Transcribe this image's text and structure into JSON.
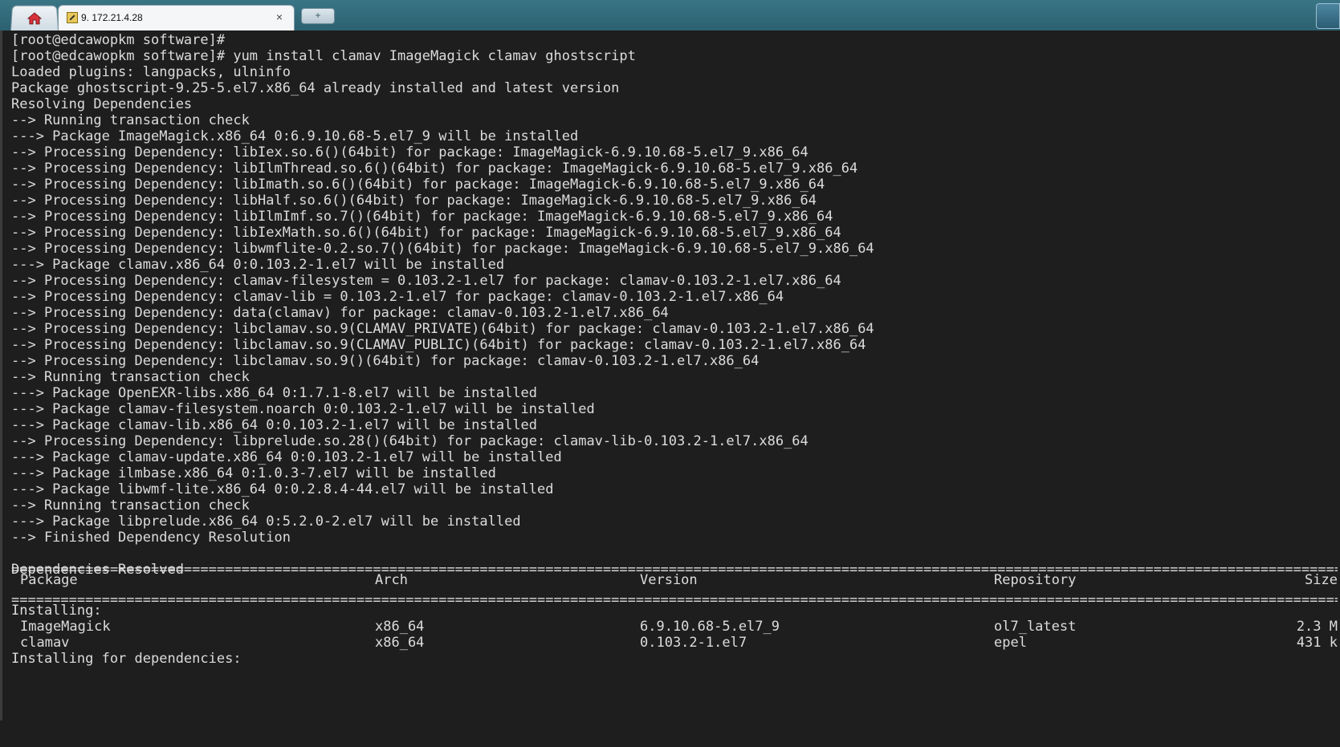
{
  "tabs": {
    "home_label": "",
    "session_label": "9. 172.21.4.28",
    "close_glyph": "×",
    "new_tab_glyph": "+"
  },
  "terminal": {
    "lines": [
      "[root@edcawopkm software]#",
      "[root@edcawopkm software]# yum install clamav ImageMagick clamav ghostscript",
      "Loaded plugins: langpacks, ulninfo",
      "Package ghostscript-9.25-5.el7.x86_64 already installed and latest version",
      "Resolving Dependencies",
      "--> Running transaction check",
      "---> Package ImageMagick.x86_64 0:6.9.10.68-5.el7_9 will be installed",
      "--> Processing Dependency: libIex.so.6()(64bit) for package: ImageMagick-6.9.10.68-5.el7_9.x86_64",
      "--> Processing Dependency: libIlmThread.so.6()(64bit) for package: ImageMagick-6.9.10.68-5.el7_9.x86_64",
      "--> Processing Dependency: libImath.so.6()(64bit) for package: ImageMagick-6.9.10.68-5.el7_9.x86_64",
      "--> Processing Dependency: libHalf.so.6()(64bit) for package: ImageMagick-6.9.10.68-5.el7_9.x86_64",
      "--> Processing Dependency: libIlmImf.so.7()(64bit) for package: ImageMagick-6.9.10.68-5.el7_9.x86_64",
      "--> Processing Dependency: libIexMath.so.6()(64bit) for package: ImageMagick-6.9.10.68-5.el7_9.x86_64",
      "--> Processing Dependency: libwmflite-0.2.so.7()(64bit) for package: ImageMagick-6.9.10.68-5.el7_9.x86_64",
      "---> Package clamav.x86_64 0:0.103.2-1.el7 will be installed",
      "--> Processing Dependency: clamav-filesystem = 0.103.2-1.el7 for package: clamav-0.103.2-1.el7.x86_64",
      "--> Processing Dependency: clamav-lib = 0.103.2-1.el7 for package: clamav-0.103.2-1.el7.x86_64",
      "--> Processing Dependency: data(clamav) for package: clamav-0.103.2-1.el7.x86_64",
      "--> Processing Dependency: libclamav.so.9(CLAMAV_PRIVATE)(64bit) for package: clamav-0.103.2-1.el7.x86_64",
      "--> Processing Dependency: libclamav.so.9(CLAMAV_PUBLIC)(64bit) for package: clamav-0.103.2-1.el7.x86_64",
      "--> Processing Dependency: libclamav.so.9()(64bit) for package: clamav-0.103.2-1.el7.x86_64",
      "--> Running transaction check",
      "---> Package OpenEXR-libs.x86_64 0:1.7.1-8.el7 will be installed",
      "---> Package clamav-filesystem.noarch 0:0.103.2-1.el7 will be installed",
      "---> Package clamav-lib.x86_64 0:0.103.2-1.el7 will be installed",
      "--> Processing Dependency: libprelude.so.28()(64bit) for package: clamav-lib-0.103.2-1.el7.x86_64",
      "---> Package clamav-update.x86_64 0:0.103.2-1.el7 will be installed",
      "---> Package ilmbase.x86_64 0:1.0.3-7.el7 will be installed",
      "---> Package libwmf-lite.x86_64 0:0.2.8.4-44.el7 will be installed",
      "--> Running transaction check",
      "---> Package libprelude.x86_64 0:5.2.0-2.el7 will be installed",
      "--> Finished Dependency Resolution",
      "",
      "Dependencies Resolved",
      ""
    ],
    "separator": "==================================================================================================================================================================================",
    "table_header": {
      "package": "Package",
      "arch": "Arch",
      "version": "Version",
      "repository": "Repository",
      "size": "Size"
    },
    "installing_label": "Installing:",
    "rows": [
      {
        "package": "ImageMagick",
        "arch": "x86_64",
        "version": "6.9.10.68-5.el7_9",
        "repository": "ol7_latest",
        "size": "2.3 M"
      },
      {
        "package": "clamav",
        "arch": "x86_64",
        "version": "0.103.2-1.el7",
        "repository": "epel",
        "size": "431 k"
      }
    ],
    "deps_label": "Installing for dependencies:"
  }
}
